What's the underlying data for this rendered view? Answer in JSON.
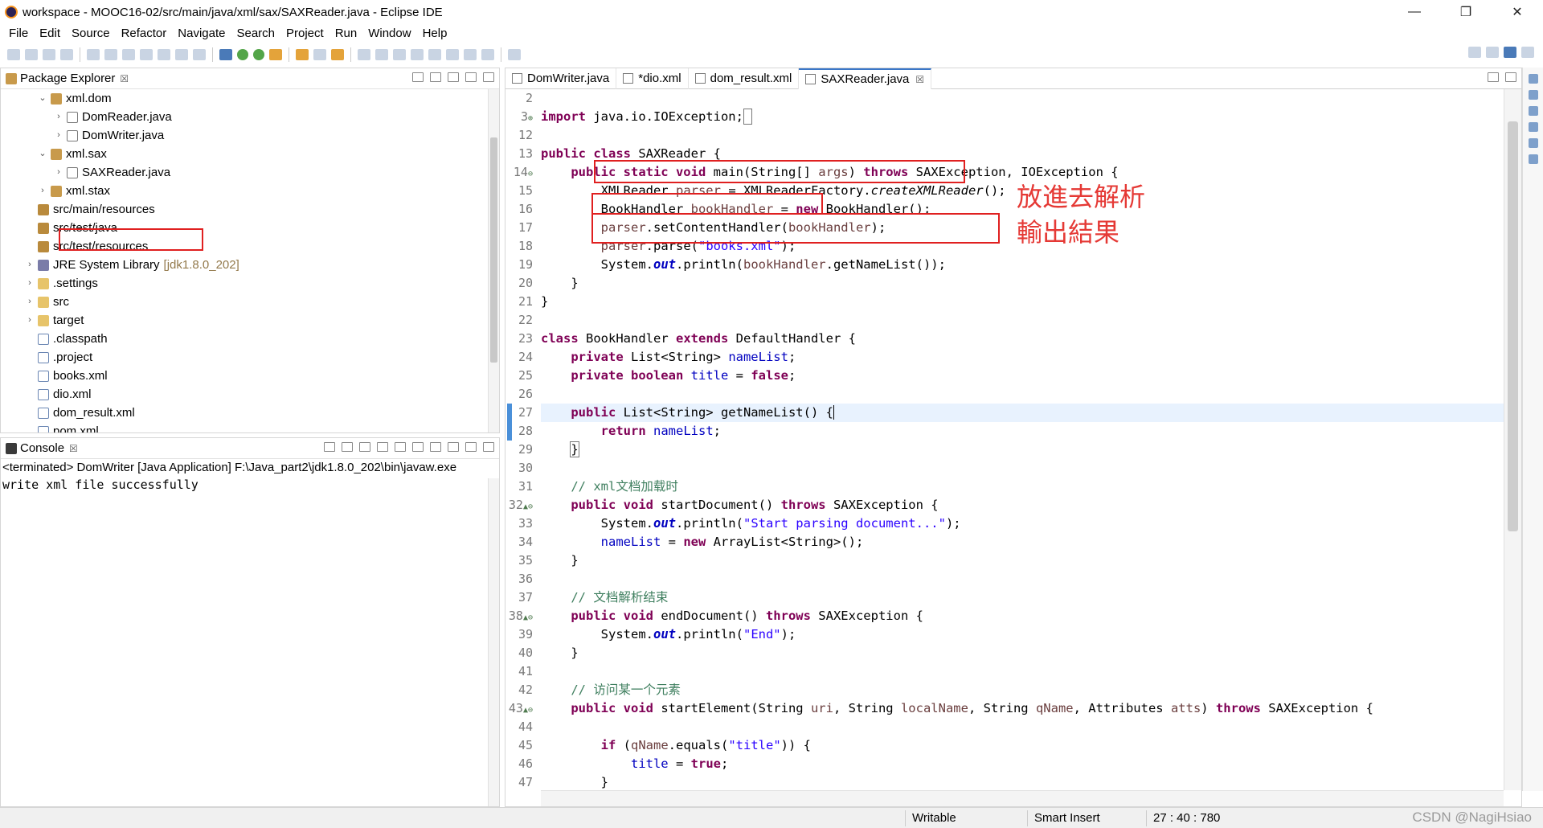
{
  "window": {
    "title": "workspace - MOOC16-02/src/main/java/xml/sax/SAXReader.java - Eclipse IDE",
    "controls": [
      "—",
      "❐",
      "✕"
    ]
  },
  "menu": [
    "File",
    "Edit",
    "Source",
    "Refactor",
    "Navigate",
    "Search",
    "Project",
    "Run",
    "Window",
    "Help"
  ],
  "package_explorer": {
    "tab_label": "Package Explorer",
    "items": [
      {
        "label": "xml.dom",
        "icon": "package-icon",
        "arrow": "⌄"
      },
      {
        "label": "DomReader.java",
        "icon": "java-file-icon",
        "arrow": "›"
      },
      {
        "label": "DomWriter.java",
        "icon": "java-file-icon",
        "arrow": "›"
      },
      {
        "label": "xml.sax",
        "icon": "package-icon",
        "arrow": "⌄"
      },
      {
        "label": "SAXReader.java",
        "icon": "java-file-icon",
        "arrow": "›"
      },
      {
        "label": "xml.stax",
        "icon": "package-icon",
        "arrow": "›"
      },
      {
        "label": "src/main/resources",
        "icon": "source-folder-icon",
        "arrow": ""
      },
      {
        "label": "src/test/java",
        "icon": "source-folder-icon",
        "arrow": ""
      },
      {
        "label": "src/test/resources",
        "icon": "source-folder-icon",
        "arrow": ""
      },
      {
        "label": "JRE System Library",
        "icon": "library-icon",
        "arrow": "›",
        "suffix": "[jdk1.8.0_202]"
      },
      {
        "label": ".settings",
        "icon": "folder-icon",
        "arrow": "›"
      },
      {
        "label": "src",
        "icon": "folder-icon",
        "arrow": "›"
      },
      {
        "label": "target",
        "icon": "folder-icon",
        "arrow": "›"
      },
      {
        "label": ".classpath",
        "icon": "xml-file-icon",
        "arrow": ""
      },
      {
        "label": ".project",
        "icon": "xml-file-icon",
        "arrow": ""
      },
      {
        "label": "books.xml",
        "icon": "xml-file-icon",
        "arrow": ""
      },
      {
        "label": "dio.xml",
        "icon": "xml-file-icon",
        "arrow": ""
      },
      {
        "label": "dom_result.xml",
        "icon": "xml-file-icon",
        "arrow": ""
      },
      {
        "label": "pom.xml",
        "icon": "xml-file-icon",
        "arrow": ""
      }
    ]
  },
  "console": {
    "tab_label": "Console",
    "terminated": "<terminated> DomWriter [Java Application] F:\\Java_part2\\jdk1.8.0_202\\bin\\javaw.exe",
    "output": "write xml file successfully"
  },
  "editor": {
    "tabs": [
      {
        "label": "DomWriter.java",
        "active": false
      },
      {
        "label": "*dio.xml",
        "active": false
      },
      {
        "label": "dom_result.xml",
        "active": false
      },
      {
        "label": "SAXReader.java",
        "active": true
      }
    ],
    "line_numbers": [
      "2",
      "3",
      "12",
      "13",
      "14",
      "15",
      "16",
      "17",
      "18",
      "19",
      "20",
      "21",
      "22",
      "23",
      "24",
      "25",
      "26",
      "27",
      "28",
      "29",
      "30",
      "31",
      "32",
      "33",
      "34",
      "35",
      "36",
      "37",
      "38",
      "39",
      "40",
      "41",
      "42",
      "43",
      "44",
      "45",
      "46",
      "47"
    ],
    "line_markers": [
      "",
      "⊕",
      "",
      "",
      "⊖",
      "",
      "",
      "",
      "",
      "",
      "",
      "",
      "",
      "",
      "",
      "",
      "",
      "",
      "",
      "",
      "",
      "",
      "▲⊖",
      "",
      "",
      "",
      "",
      "",
      "▲⊖",
      "",
      "",
      "",
      "",
      "▲⊖",
      "",
      "",
      "",
      ""
    ],
    "annotation_lines": [
      "放進去解析",
      "輸出結果"
    ]
  },
  "status_bar": {
    "writable": "Writable",
    "insert_mode": "Smart Insert",
    "position": "27 : 40 : 780",
    "watermark": "CSDN @NagiHsiao"
  },
  "colors": {
    "highlight_box": "#e02020",
    "annotation_text": "#e53935",
    "keyword": "#7f0055",
    "string": "#2a00ff",
    "field": "#0000c0",
    "comment": "#3f7f5f"
  }
}
